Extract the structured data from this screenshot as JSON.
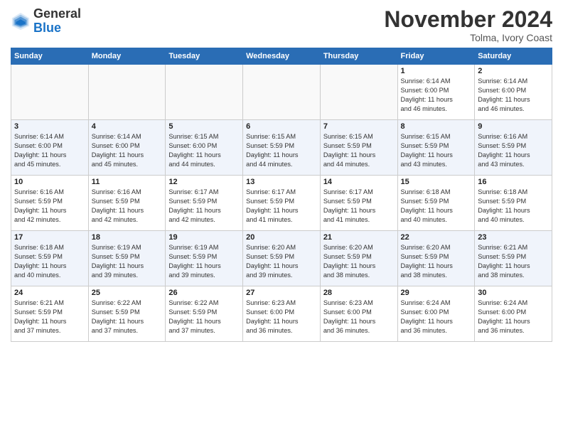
{
  "logo": {
    "general": "General",
    "blue": "Blue"
  },
  "header": {
    "month": "November 2024",
    "location": "Tolma, Ivory Coast"
  },
  "weekdays": [
    "Sunday",
    "Monday",
    "Tuesday",
    "Wednesday",
    "Thursday",
    "Friday",
    "Saturday"
  ],
  "weeks": [
    [
      {
        "day": "",
        "info": ""
      },
      {
        "day": "",
        "info": ""
      },
      {
        "day": "",
        "info": ""
      },
      {
        "day": "",
        "info": ""
      },
      {
        "day": "",
        "info": ""
      },
      {
        "day": "1",
        "info": "Sunrise: 6:14 AM\nSunset: 6:00 PM\nDaylight: 11 hours\nand 46 minutes."
      },
      {
        "day": "2",
        "info": "Sunrise: 6:14 AM\nSunset: 6:00 PM\nDaylight: 11 hours\nand 46 minutes."
      }
    ],
    [
      {
        "day": "3",
        "info": "Sunrise: 6:14 AM\nSunset: 6:00 PM\nDaylight: 11 hours\nand 45 minutes."
      },
      {
        "day": "4",
        "info": "Sunrise: 6:14 AM\nSunset: 6:00 PM\nDaylight: 11 hours\nand 45 minutes."
      },
      {
        "day": "5",
        "info": "Sunrise: 6:15 AM\nSunset: 6:00 PM\nDaylight: 11 hours\nand 44 minutes."
      },
      {
        "day": "6",
        "info": "Sunrise: 6:15 AM\nSunset: 5:59 PM\nDaylight: 11 hours\nand 44 minutes."
      },
      {
        "day": "7",
        "info": "Sunrise: 6:15 AM\nSunset: 5:59 PM\nDaylight: 11 hours\nand 44 minutes."
      },
      {
        "day": "8",
        "info": "Sunrise: 6:15 AM\nSunset: 5:59 PM\nDaylight: 11 hours\nand 43 minutes."
      },
      {
        "day": "9",
        "info": "Sunrise: 6:16 AM\nSunset: 5:59 PM\nDaylight: 11 hours\nand 43 minutes."
      }
    ],
    [
      {
        "day": "10",
        "info": "Sunrise: 6:16 AM\nSunset: 5:59 PM\nDaylight: 11 hours\nand 42 minutes."
      },
      {
        "day": "11",
        "info": "Sunrise: 6:16 AM\nSunset: 5:59 PM\nDaylight: 11 hours\nand 42 minutes."
      },
      {
        "day": "12",
        "info": "Sunrise: 6:17 AM\nSunset: 5:59 PM\nDaylight: 11 hours\nand 42 minutes."
      },
      {
        "day": "13",
        "info": "Sunrise: 6:17 AM\nSunset: 5:59 PM\nDaylight: 11 hours\nand 41 minutes."
      },
      {
        "day": "14",
        "info": "Sunrise: 6:17 AM\nSunset: 5:59 PM\nDaylight: 11 hours\nand 41 minutes."
      },
      {
        "day": "15",
        "info": "Sunrise: 6:18 AM\nSunset: 5:59 PM\nDaylight: 11 hours\nand 40 minutes."
      },
      {
        "day": "16",
        "info": "Sunrise: 6:18 AM\nSunset: 5:59 PM\nDaylight: 11 hours\nand 40 minutes."
      }
    ],
    [
      {
        "day": "17",
        "info": "Sunrise: 6:18 AM\nSunset: 5:59 PM\nDaylight: 11 hours\nand 40 minutes."
      },
      {
        "day": "18",
        "info": "Sunrise: 6:19 AM\nSunset: 5:59 PM\nDaylight: 11 hours\nand 39 minutes."
      },
      {
        "day": "19",
        "info": "Sunrise: 6:19 AM\nSunset: 5:59 PM\nDaylight: 11 hours\nand 39 minutes."
      },
      {
        "day": "20",
        "info": "Sunrise: 6:20 AM\nSunset: 5:59 PM\nDaylight: 11 hours\nand 39 minutes."
      },
      {
        "day": "21",
        "info": "Sunrise: 6:20 AM\nSunset: 5:59 PM\nDaylight: 11 hours\nand 38 minutes."
      },
      {
        "day": "22",
        "info": "Sunrise: 6:20 AM\nSunset: 5:59 PM\nDaylight: 11 hours\nand 38 minutes."
      },
      {
        "day": "23",
        "info": "Sunrise: 6:21 AM\nSunset: 5:59 PM\nDaylight: 11 hours\nand 38 minutes."
      }
    ],
    [
      {
        "day": "24",
        "info": "Sunrise: 6:21 AM\nSunset: 5:59 PM\nDaylight: 11 hours\nand 37 minutes."
      },
      {
        "day": "25",
        "info": "Sunrise: 6:22 AM\nSunset: 5:59 PM\nDaylight: 11 hours\nand 37 minutes."
      },
      {
        "day": "26",
        "info": "Sunrise: 6:22 AM\nSunset: 5:59 PM\nDaylight: 11 hours\nand 37 minutes."
      },
      {
        "day": "27",
        "info": "Sunrise: 6:23 AM\nSunset: 6:00 PM\nDaylight: 11 hours\nand 36 minutes."
      },
      {
        "day": "28",
        "info": "Sunrise: 6:23 AM\nSunset: 6:00 PM\nDaylight: 11 hours\nand 36 minutes."
      },
      {
        "day": "29",
        "info": "Sunrise: 6:24 AM\nSunset: 6:00 PM\nDaylight: 11 hours\nand 36 minutes."
      },
      {
        "day": "30",
        "info": "Sunrise: 6:24 AM\nSunset: 6:00 PM\nDaylight: 11 hours\nand 36 minutes."
      }
    ]
  ]
}
